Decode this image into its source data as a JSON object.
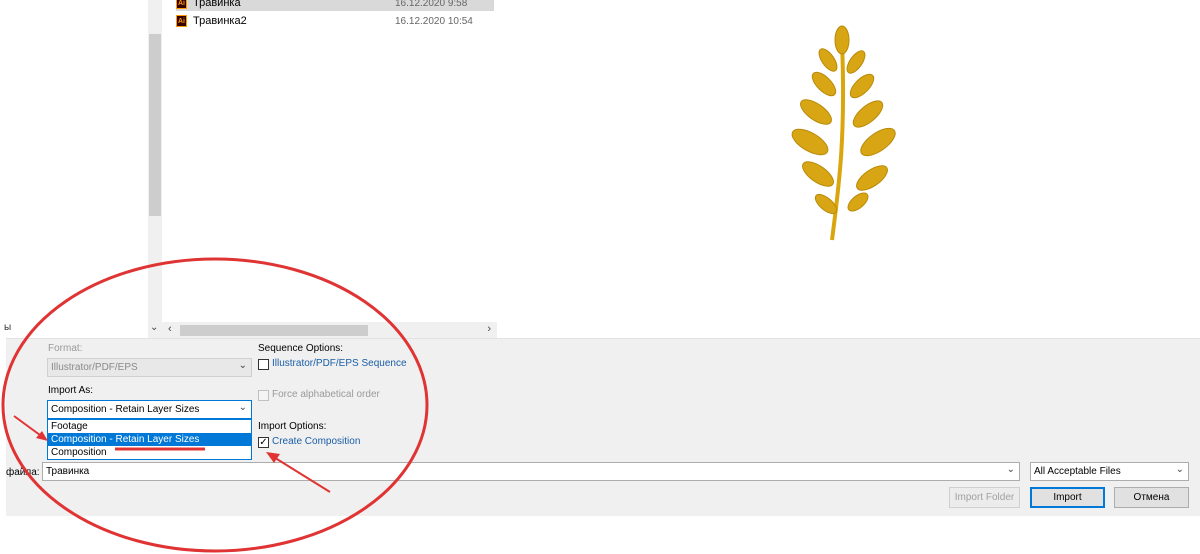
{
  "side_label": "ы",
  "files": [
    {
      "name": "Травинка",
      "date": "16.12.2020 9:58",
      "icon": "ai-file-icon",
      "icon_text": "Ai",
      "selected": true
    },
    {
      "name": "Травинка2",
      "date": "16.12.2020 10:54",
      "icon": "ai-file-icon",
      "icon_text": "Ai",
      "selected": false
    }
  ],
  "preview": {
    "icon": "leaf-preview-image"
  },
  "format": {
    "label": "Format:",
    "value": "Illustrator/PDF/EPS"
  },
  "import_as": {
    "label": "Import As:",
    "value": "Composition - Retain Layer Sizes",
    "options": [
      "Footage",
      "Composition - Retain Layer Sizes",
      "Composition"
    ],
    "highlighted_index": 1
  },
  "sequence_options": {
    "label": "Sequence Options:",
    "sequence_checkbox": {
      "label": "Illustrator/PDF/EPS Sequence",
      "checked": false
    },
    "alpha_checkbox": {
      "label": "Force alphabetical order",
      "checked": false,
      "disabled": true
    }
  },
  "import_options": {
    "label": "Import Options:",
    "create_comp_checkbox": {
      "label": "Create Composition",
      "checked": true,
      "mark": "✓"
    }
  },
  "filename": {
    "label": "файла:",
    "value": "Травинка"
  },
  "file_type": {
    "value": "All Acceptable Files"
  },
  "buttons": {
    "import_folder": "Import Folder",
    "import": "Import",
    "cancel": "Отмена"
  },
  "colors": {
    "annotation": "#e03434",
    "accent": "#0078d7",
    "link": "#1a5ea8"
  }
}
